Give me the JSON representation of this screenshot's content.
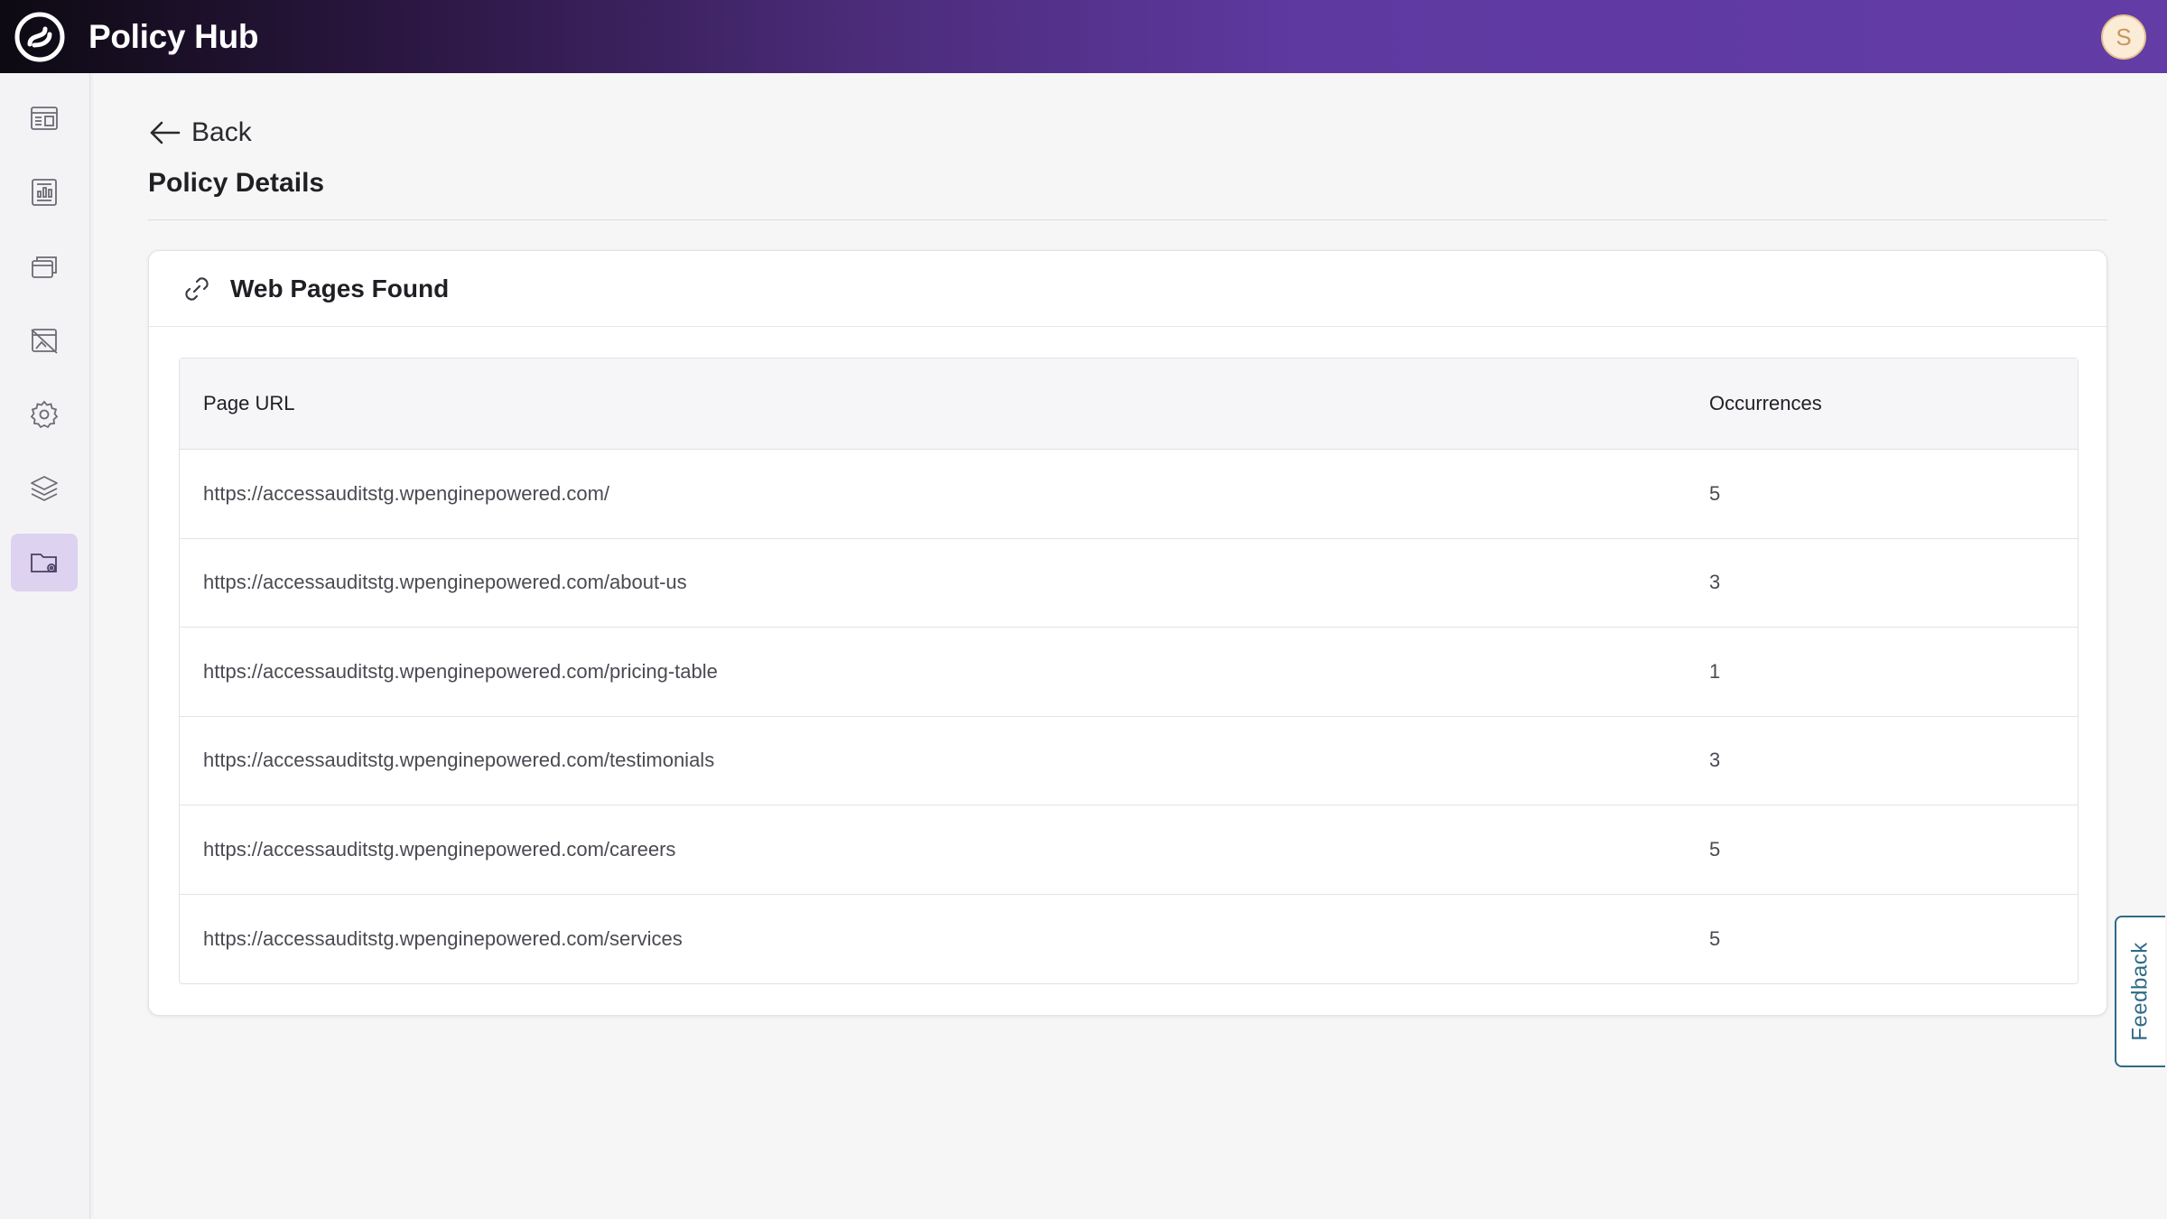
{
  "header": {
    "app_title": "Policy Hub",
    "avatar_initial": "S",
    "logo_icon": "swirl-logo-icon"
  },
  "sidebar": {
    "items": [
      {
        "icon": "dashboard-icon",
        "active": false
      },
      {
        "icon": "report-icon",
        "active": false
      },
      {
        "icon": "windows-icon",
        "active": false
      },
      {
        "icon": "no-image-icon",
        "active": false
      },
      {
        "icon": "gear-icon",
        "active": false
      },
      {
        "icon": "layers-icon",
        "active": false
      },
      {
        "icon": "folder-settings-icon",
        "active": true
      }
    ]
  },
  "page": {
    "back_label": "Back",
    "title": "Policy Details"
  },
  "card": {
    "title": "Web Pages Found",
    "icon": "link-icon"
  },
  "table": {
    "columns": [
      "Page URL",
      "Occurrences"
    ],
    "rows": [
      {
        "url": "https://accessauditstg.wpenginepowered.com/",
        "occurrences": "5"
      },
      {
        "url": "https://accessauditstg.wpenginepowered.com/about-us",
        "occurrences": "3"
      },
      {
        "url": "https://accessauditstg.wpenginepowered.com/pricing-table",
        "occurrences": "1"
      },
      {
        "url": "https://accessauditstg.wpenginepowered.com/testimonials",
        "occurrences": "3"
      },
      {
        "url": "https://accessauditstg.wpenginepowered.com/careers",
        "occurrences": "5"
      },
      {
        "url": "https://accessauditstg.wpenginepowered.com/services",
        "occurrences": "5"
      }
    ]
  },
  "feedback_label": "Feedback",
  "colors": {
    "accent": "#633ca6",
    "active_nav_bg": "#ddd2ef",
    "feedback": "#2f6b86"
  }
}
